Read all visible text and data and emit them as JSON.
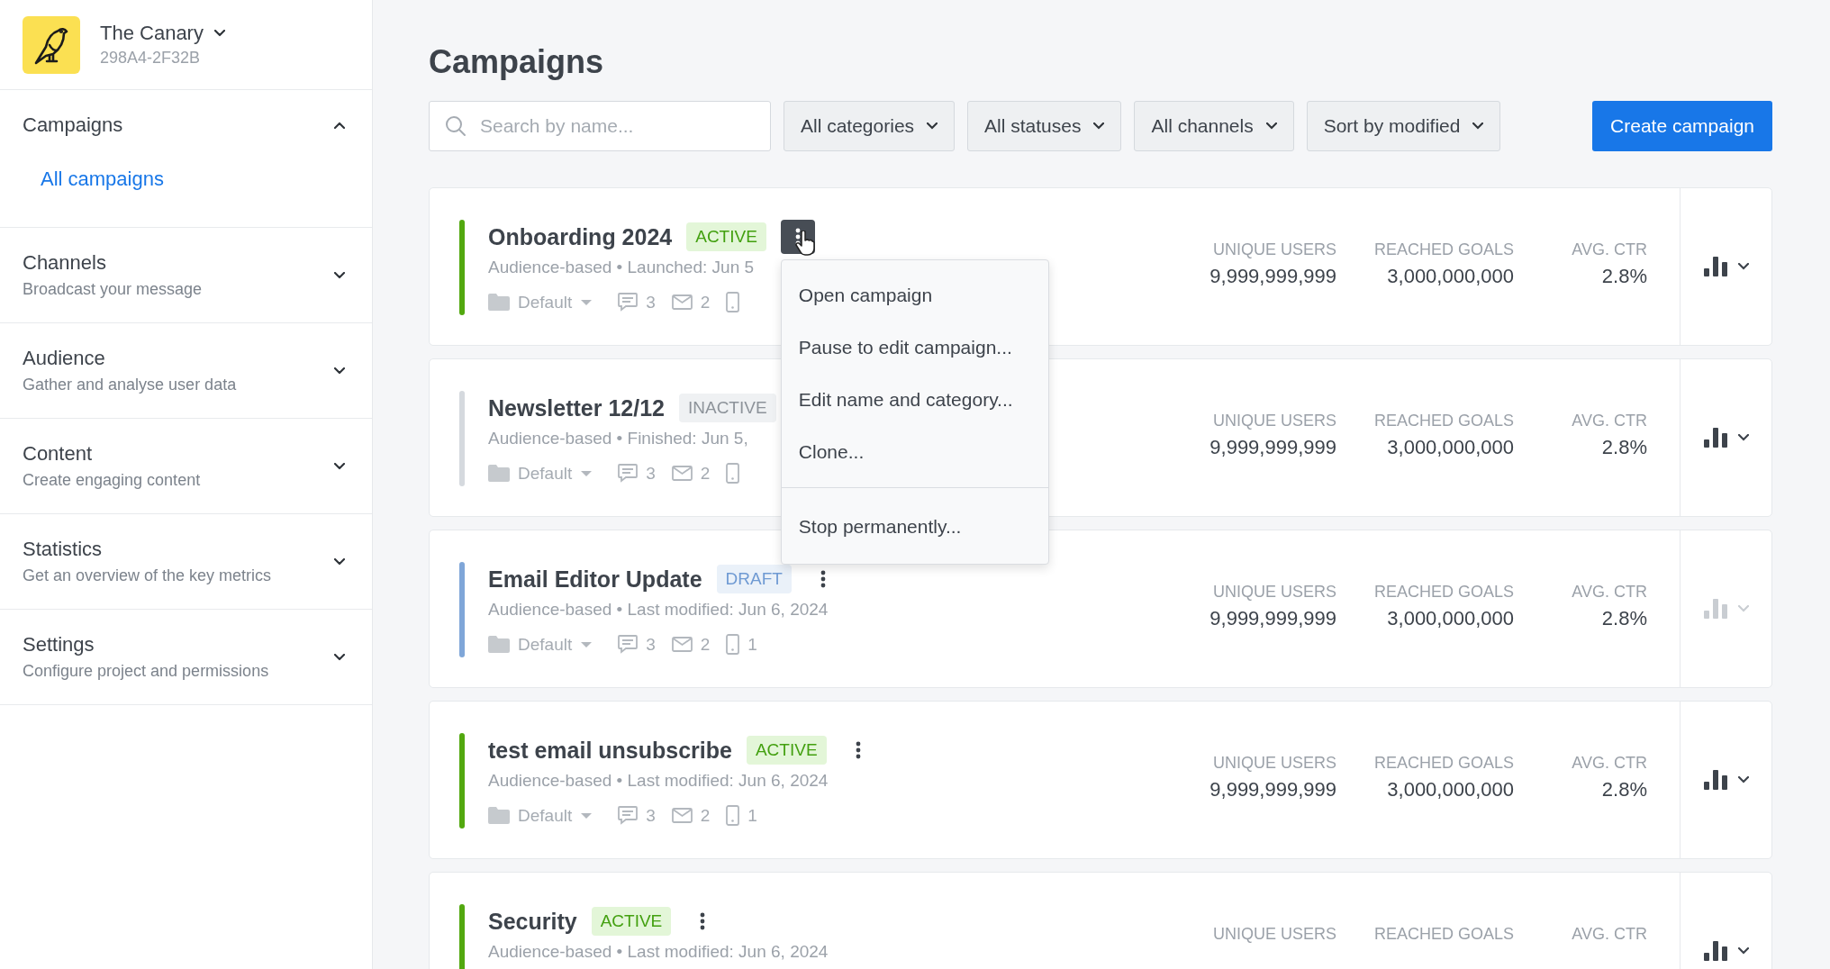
{
  "workspace": {
    "name": "The Canary",
    "id": "298A4-2F32B"
  },
  "sidebar": {
    "sections": [
      {
        "title": "Campaigns",
        "expanded": true,
        "children": [
          {
            "label": "All campaigns",
            "selected": true
          }
        ]
      },
      {
        "title": "Channels",
        "subtitle": "Broadcast your message",
        "expanded": false
      },
      {
        "title": "Audience",
        "subtitle": "Gather and analyse user data",
        "expanded": false
      },
      {
        "title": "Content",
        "subtitle": "Create engaging content",
        "expanded": false
      },
      {
        "title": "Statistics",
        "subtitle": "Get an overview of the key metrics",
        "expanded": false
      },
      {
        "title": "Settings",
        "subtitle": "Configure project and permissions",
        "expanded": false
      }
    ]
  },
  "page_title": "Campaigns",
  "search": {
    "placeholder": "Search by name..."
  },
  "filters": [
    "All categories",
    "All statuses",
    "All channels",
    "Sort by modified"
  ],
  "create_button": "Create campaign",
  "campaigns": [
    {
      "name": "Onboarding 2024",
      "status": "ACTIVE",
      "kind": "active",
      "menu_open": true,
      "meta": "Audience-based • Launched: Jun 5",
      "folder": "Default",
      "messages": "3",
      "emails": "2",
      "chart_enabled": true,
      "stats": [
        {
          "label": "UNIQUE USERS",
          "value": "9,999,999,999"
        },
        {
          "label": "REACHED GOALS",
          "value": "3,000,000,000"
        },
        {
          "label": "AVG. CTR",
          "value": "2.8%"
        }
      ]
    },
    {
      "name": "Newsletter 12/12",
      "status": "INACTIVE",
      "kind": "inactive",
      "menu_open": false,
      "meta": "Audience-based • Finished: Jun 5,",
      "folder": "Default",
      "messages": "3",
      "emails": "2",
      "chart_enabled": true,
      "stats": [
        {
          "label": "UNIQUE USERS",
          "value": "9,999,999,999"
        },
        {
          "label": "REACHED GOALS",
          "value": "3,000,000,000"
        },
        {
          "label": "AVG. CTR",
          "value": "2.8%"
        }
      ]
    },
    {
      "name": "Email Editor Update",
      "status": "DRAFT",
      "kind": "draft",
      "menu_open": false,
      "meta": "Audience-based • Last modified: Jun 6, 2024",
      "folder": "Default",
      "messages": "3",
      "emails": "2",
      "devices": "1",
      "chart_enabled": false,
      "stats": [
        {
          "label": "UNIQUE USERS",
          "value": "9,999,999,999"
        },
        {
          "label": "REACHED GOALS",
          "value": "3,000,000,000"
        },
        {
          "label": "AVG. CTR",
          "value": "2.8%"
        }
      ]
    },
    {
      "name": "test email unsubscribe",
      "status": "ACTIVE",
      "kind": "active",
      "menu_open": false,
      "meta": "Audience-based • Last modified: Jun 6, 2024",
      "folder": "Default",
      "messages": "3",
      "emails": "2",
      "devices": "1",
      "chart_enabled": true,
      "stats": [
        {
          "label": "UNIQUE USERS",
          "value": "9,999,999,999"
        },
        {
          "label": "REACHED GOALS",
          "value": "3,000,000,000"
        },
        {
          "label": "AVG. CTR",
          "value": "2.8%"
        }
      ]
    },
    {
      "name": "Security",
      "status": "ACTIVE",
      "kind": "active",
      "menu_open": false,
      "meta": "Audience-based • Last modified: Jun 6, 2024",
      "chart_enabled": true,
      "stats": [
        {
          "label": "UNIQUE USERS"
        },
        {
          "label": "REACHED GOALS"
        },
        {
          "label": "AVG. CTR"
        }
      ]
    }
  ],
  "menu": {
    "groups": [
      [
        "Open campaign",
        "Pause to edit campaign...",
        "Edit name and category...",
        "Clone..."
      ],
      [
        "Stop permanently..."
      ]
    ]
  }
}
